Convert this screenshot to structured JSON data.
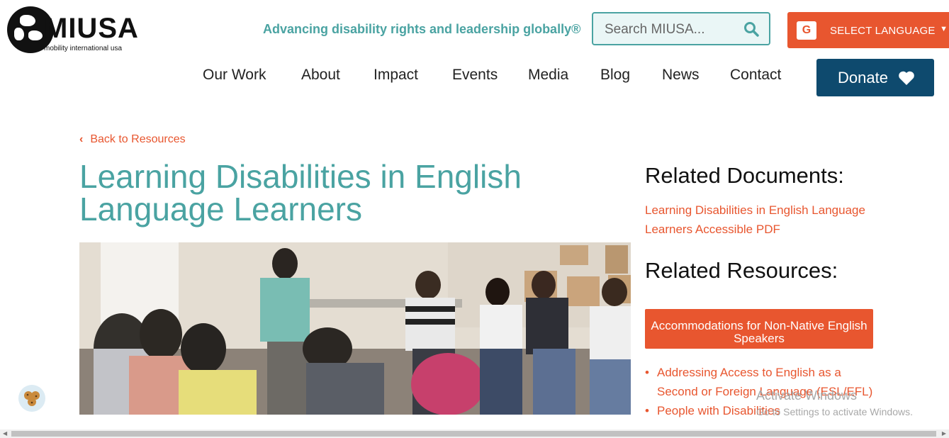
{
  "brand": {
    "name": "MIUSA",
    "subtitle": "mobility international usa"
  },
  "header": {
    "tagline": "Advancing disability rights and leadership globally®",
    "search_placeholder": "Search MIUSA...",
    "language_label": "SELECT LANGUAGE",
    "donate_label": "Donate"
  },
  "nav": [
    "Our Work",
    "About",
    "Impact",
    "Events",
    "Media",
    "Blog",
    "News",
    "Contact"
  ],
  "page": {
    "back_link": "Back to Resources",
    "title": "Learning Disabilities in English Language Learners"
  },
  "sidebar": {
    "related_documents_heading": "Related Documents:",
    "related_document_link": "Learning Disabilities in English Language Learners Accessible PDF",
    "related_resources_heading": "Related Resources:",
    "resource_button": "Accommodations for Non-Native English Speakers",
    "resource_links": [
      "Addressing Access to English as a Second or Foreign Language (ESL/EFL)",
      "People with Disabilities"
    ]
  },
  "os_overlay": {
    "activate_title": "Activate Windows",
    "activate_sub": "Go to Settings to activate Windows."
  },
  "colors": {
    "teal": "#4aa3a2",
    "orange": "#e8562f",
    "navy": "#0e4a6e"
  }
}
